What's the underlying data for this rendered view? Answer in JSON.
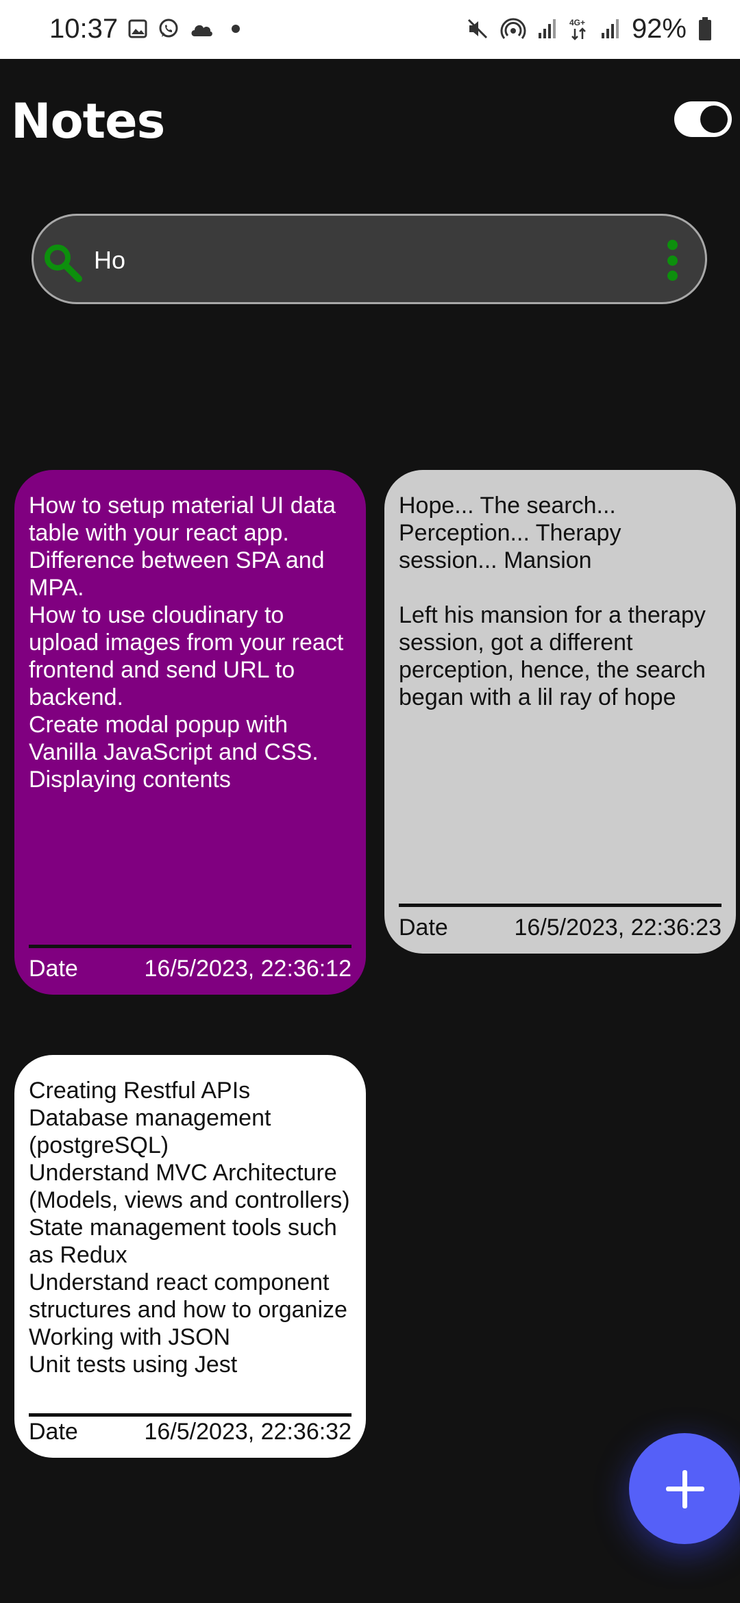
{
  "status_bar": {
    "time": "10:37",
    "battery": "92%",
    "left_icons": [
      "image-icon",
      "whatsapp-icon",
      "cloud-icon",
      "dot-icon"
    ],
    "right_icons": [
      "mute-icon",
      "hotspot-icon",
      "signal-icon",
      "network-4g-icon",
      "signal-icon",
      "battery-icon"
    ]
  },
  "header": {
    "title": "Notes",
    "theme_toggle": "on"
  },
  "search": {
    "value": "Ho",
    "placeholder": ""
  },
  "notes": [
    {
      "text": "How to setup material UI data table with your react app.\nDifference between SPA and MPA.\nHow to use cloudinary to upload images from your react frontend and send URL to backend.\nCreate modal popup with Vanilla JavaScript and CSS.\nDisplaying contents",
      "date_label": "Date",
      "date": "16/5/2023, 22:36:12",
      "color": "#800080"
    },
    {
      "text": "Hope... The search... Perception... Therapy session... Mansion\n\nLeft his mansion for a therapy session, got a different perception, hence, the search began with a lil ray of hope",
      "date_label": "Date",
      "date": "16/5/2023, 22:36:23",
      "color": "#cccccc"
    },
    {
      "text": "Creating Restful APIs\nDatabase management (postgreSQL)\nUnderstand MVC Architecture (Models, views and controllers)\nState management tools such as Redux\nUnderstand react component structures and how to organize\nWorking with JSON\nUnit tests using Jest",
      "date_label": "Date",
      "date": "16/5/2023, 22:36:32",
      "color": "#ffffff"
    }
  ],
  "colors": {
    "background": "#121212",
    "accent_green": "#0d8f0d",
    "fab": "#5560f8"
  }
}
